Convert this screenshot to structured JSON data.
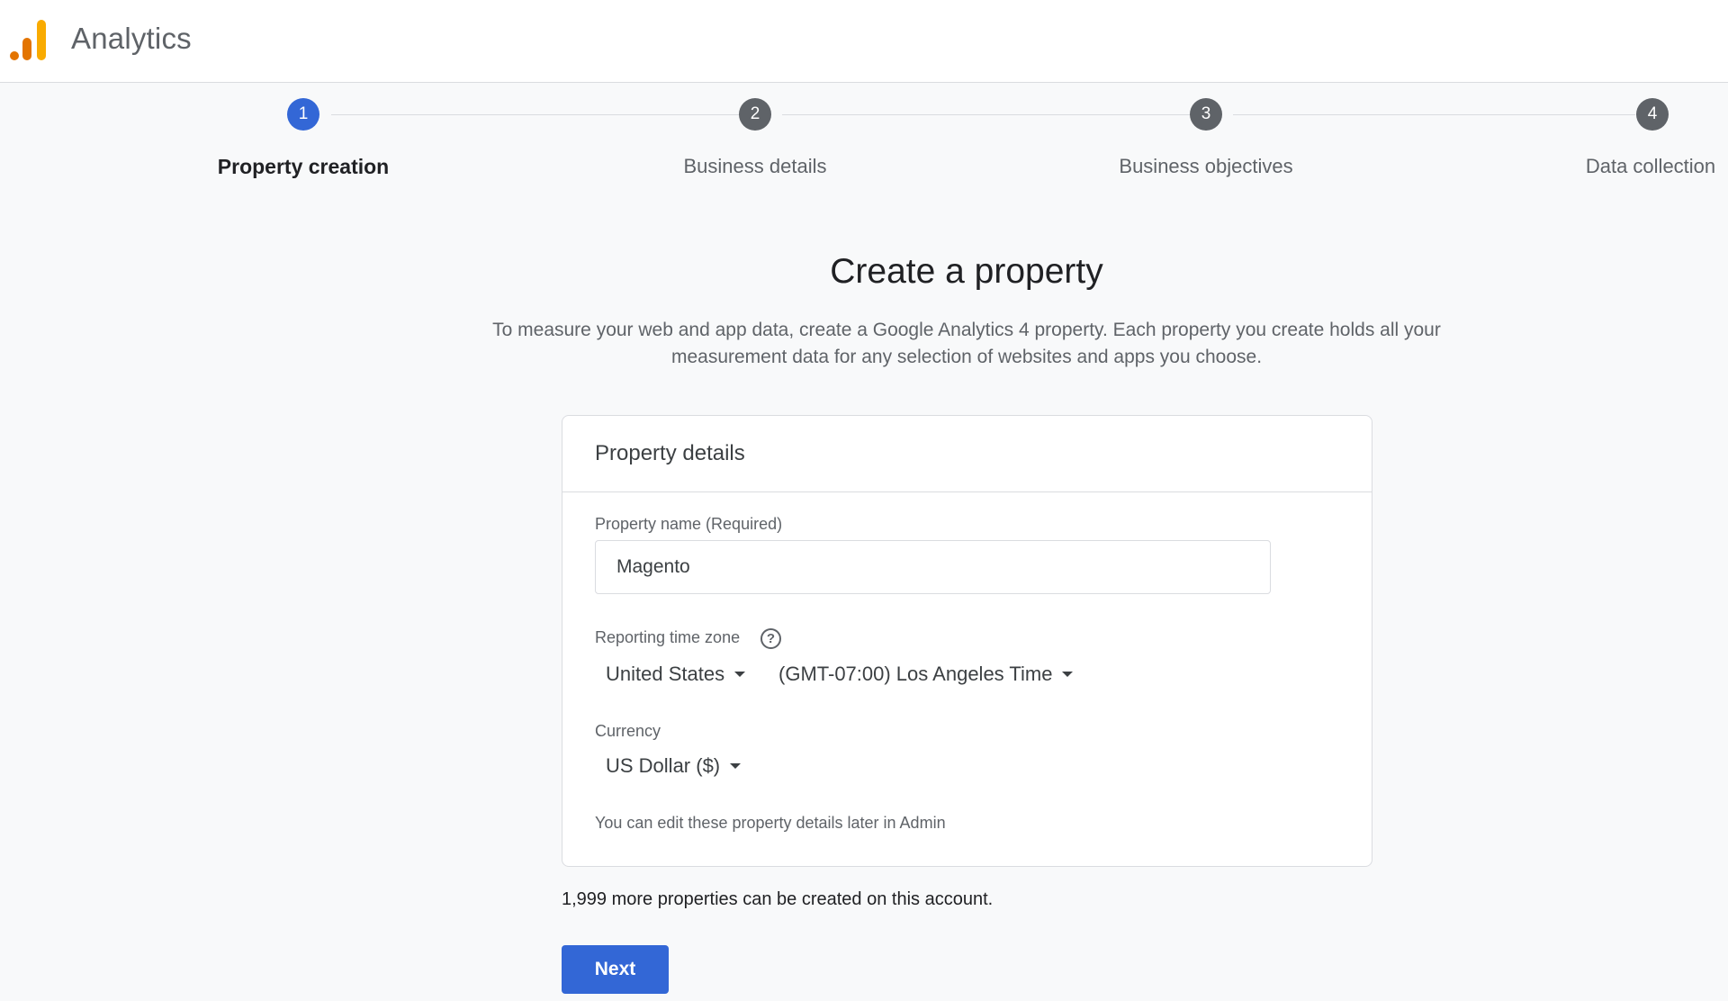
{
  "header": {
    "app_title": "Analytics",
    "logo_icon": "analytics-bar-chart-logo",
    "logo_colors": [
      "#e37400",
      "#f9ab00"
    ]
  },
  "stepper": {
    "active_step": 1,
    "steps": [
      {
        "number": "1",
        "label": "Property creation"
      },
      {
        "number": "2",
        "label": "Business details"
      },
      {
        "number": "3",
        "label": "Business objectives"
      },
      {
        "number": "4",
        "label": "Data collection"
      }
    ]
  },
  "page": {
    "title": "Create a property",
    "description": "To measure your web and app data, create a Google Analytics 4 property. Each property you create holds all your measurement data for any selection of websites and apps you choose."
  },
  "property_details": {
    "heading": "Property details",
    "property_name": {
      "label": "Property name (Required)",
      "value": "Magento"
    },
    "time_zone": {
      "label": "Reporting time zone",
      "help_icon": "help-circle-icon",
      "country": "United States",
      "zone": "(GMT-07:00) Los Angeles Time"
    },
    "currency": {
      "label": "Currency",
      "value": "US Dollar ($)"
    },
    "note": "You can edit these property details later in Admin"
  },
  "quota_note": "1,999 more properties can be created on this account.",
  "actions": {
    "next_label": "Next"
  },
  "colors": {
    "accent": "#3367d6",
    "page_background": "#f8f9fa"
  }
}
